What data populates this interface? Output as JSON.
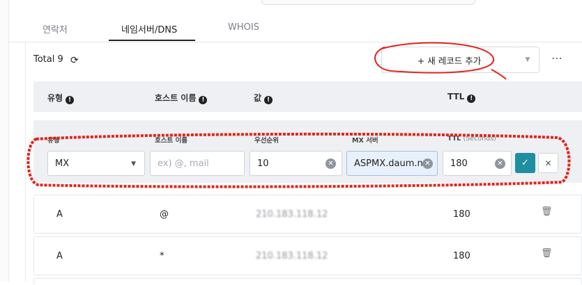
{
  "tabs": [
    "연락처",
    "네임서버/DNS",
    "WHOIS"
  ],
  "toolbar": {
    "total_label": "Total 9",
    "refresh_icon": "refresh-icon",
    "add_record_label": "+ 새 레코드 추가",
    "dropdown_icon": "caret-down-icon",
    "more_label": "⋯"
  },
  "table": {
    "headers": [
      {
        "label": "유형"
      },
      {
        "label": "호스트 이름"
      },
      {
        "label": "값"
      },
      {
        "label": "TTL"
      }
    ]
  },
  "edit_form": {
    "labels": {
      "type": "유형",
      "host": "호스트 이름",
      "priority": "우선순위",
      "mx": "MX 서버",
      "ttl": "TTL",
      "ttl_unit": "(Seconds)"
    },
    "type_value": "MX",
    "host_placeholder": "ex) @, mail",
    "priority_value": "10",
    "mx_value": "ASPMX.daum.n",
    "ttl_value": "180"
  },
  "records": [
    {
      "type": "A",
      "host": "@",
      "value": "210.183.118.12",
      "ttl": "180"
    },
    {
      "type": "A",
      "host": "*",
      "value": "210.183.118.12",
      "ttl": "180"
    }
  ],
  "colors": {
    "accent": "#1f8ea0",
    "annotation": "#e3241b",
    "header_bg": "#eef0f3"
  }
}
